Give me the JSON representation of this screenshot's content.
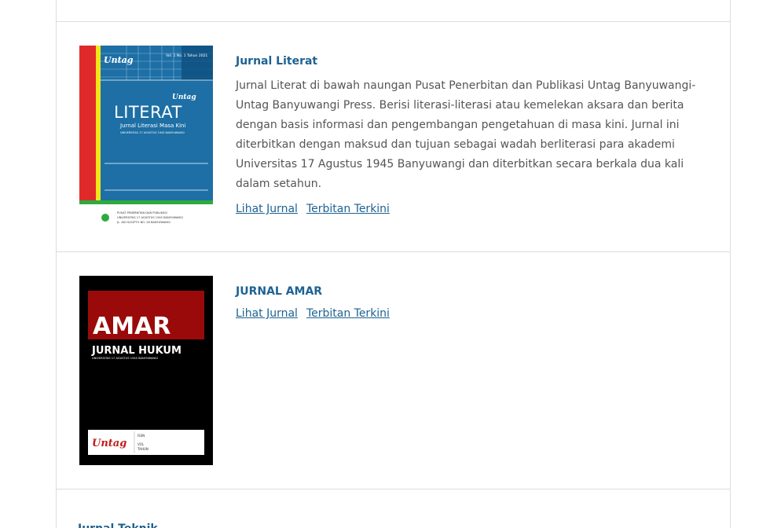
{
  "journals": [
    {
      "title": "Jurnal Literat",
      "description": "Jurnal Literat di bawah naungan Pusat Penerbitan dan Publikasi Untag Banyuwangi-Untag Banyuwangi Press. Berisi literasi-literasi atau kemelekan aksara dan berita dengan basis informasi dan pengembangan pengetahuan di masa kini. Jurnal ini diterbitkan dengan maksud dan tujuan sebagai wadah berliterasi para akademi Universitas 17 Agustus 1945 Banyuwangi dan diterbitkan secara berkala dua kali dalam setahun.",
      "view_link": "Lihat Jurnal",
      "current_link": "Terbitan Terkini",
      "cover": {
        "issue": "Vol. 1 No. 1 Tahun 2021",
        "brand": "Untag",
        "name": "LITERAT",
        "subtitle": "Jurnal Literasi Masa Kini",
        "university": "UNIVERSITAS 17 AGUSTUS 1945 BANYUWANGI",
        "publisher": "PUSAT PENERBITAN DAN PUBLIKASI",
        "address": "JL. ADI SUCIPTO NO. 26 BANYUWANGI",
        "colors": {
          "bg": "#1d6fa5",
          "left_bar": "#e02a2a",
          "stripe": "#f2e51a",
          "bottom": "#2eaa3f"
        }
      }
    },
    {
      "title": "JURNAL AMAR",
      "view_link": "Lihat Jurnal",
      "current_link": "Terbitan Terkini",
      "cover": {
        "name": "AMAR",
        "subtitle": "JURNAL HUKUM",
        "university": "UNIVERSITAS 17 AGUSTUS 1945 BANYUWANGI",
        "brand": "Untag",
        "issn_label": "ISSN",
        "vol_label": "VOL",
        "year_label": "TAHUN",
        "colors": {
          "bg": "#000000",
          "banner": "#9b0a0a"
        }
      }
    },
    {
      "title": "Jurnal Teknik"
    }
  ]
}
